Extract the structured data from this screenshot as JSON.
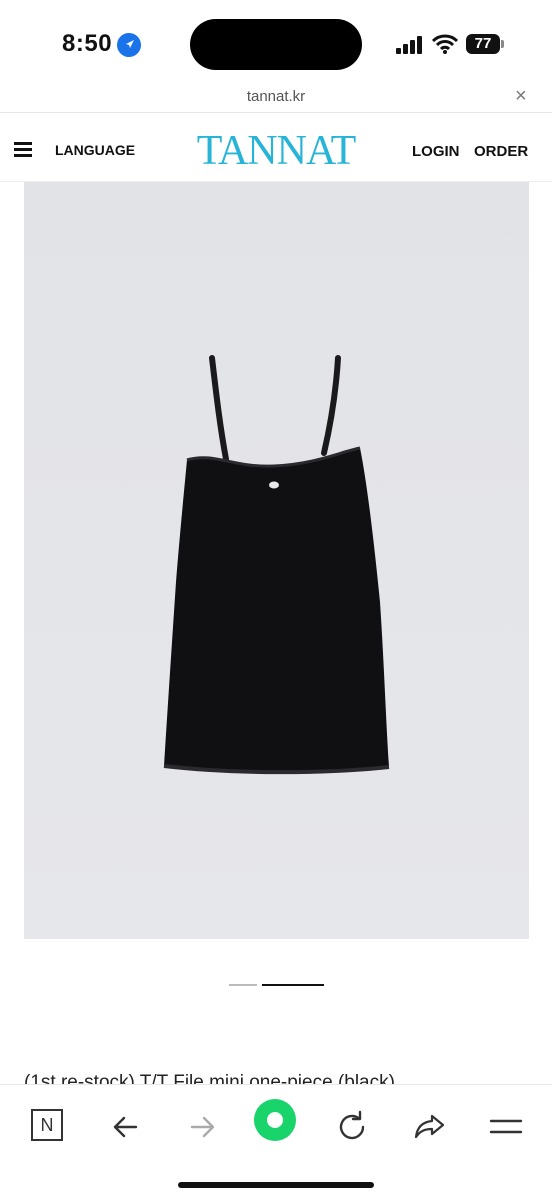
{
  "status_bar": {
    "time": "8:50",
    "battery": "77"
  },
  "browser": {
    "url": "tannat.kr",
    "close_glyph": "×"
  },
  "header": {
    "language_label": "LANGUAGE",
    "logo_text": "TANNAT",
    "login_label": "LOGIN",
    "order_label": "ORDER"
  },
  "product": {
    "title": "(1st re-stock) T/T File mini one-piece (black)",
    "image_icon": "black-mini-dress-image",
    "carousel_pages": 2,
    "carousel_active": 2
  },
  "toolbar": {
    "n_label": "N",
    "icons": [
      "naver-n-icon",
      "back-arrow-icon",
      "forward-arrow-icon",
      "home-green-icon",
      "refresh-icon",
      "share-icon",
      "menu-icon"
    ]
  },
  "colors": {
    "logo": "#27b4d6",
    "home_button": "#19d36b",
    "location": "#1a73e8"
  }
}
